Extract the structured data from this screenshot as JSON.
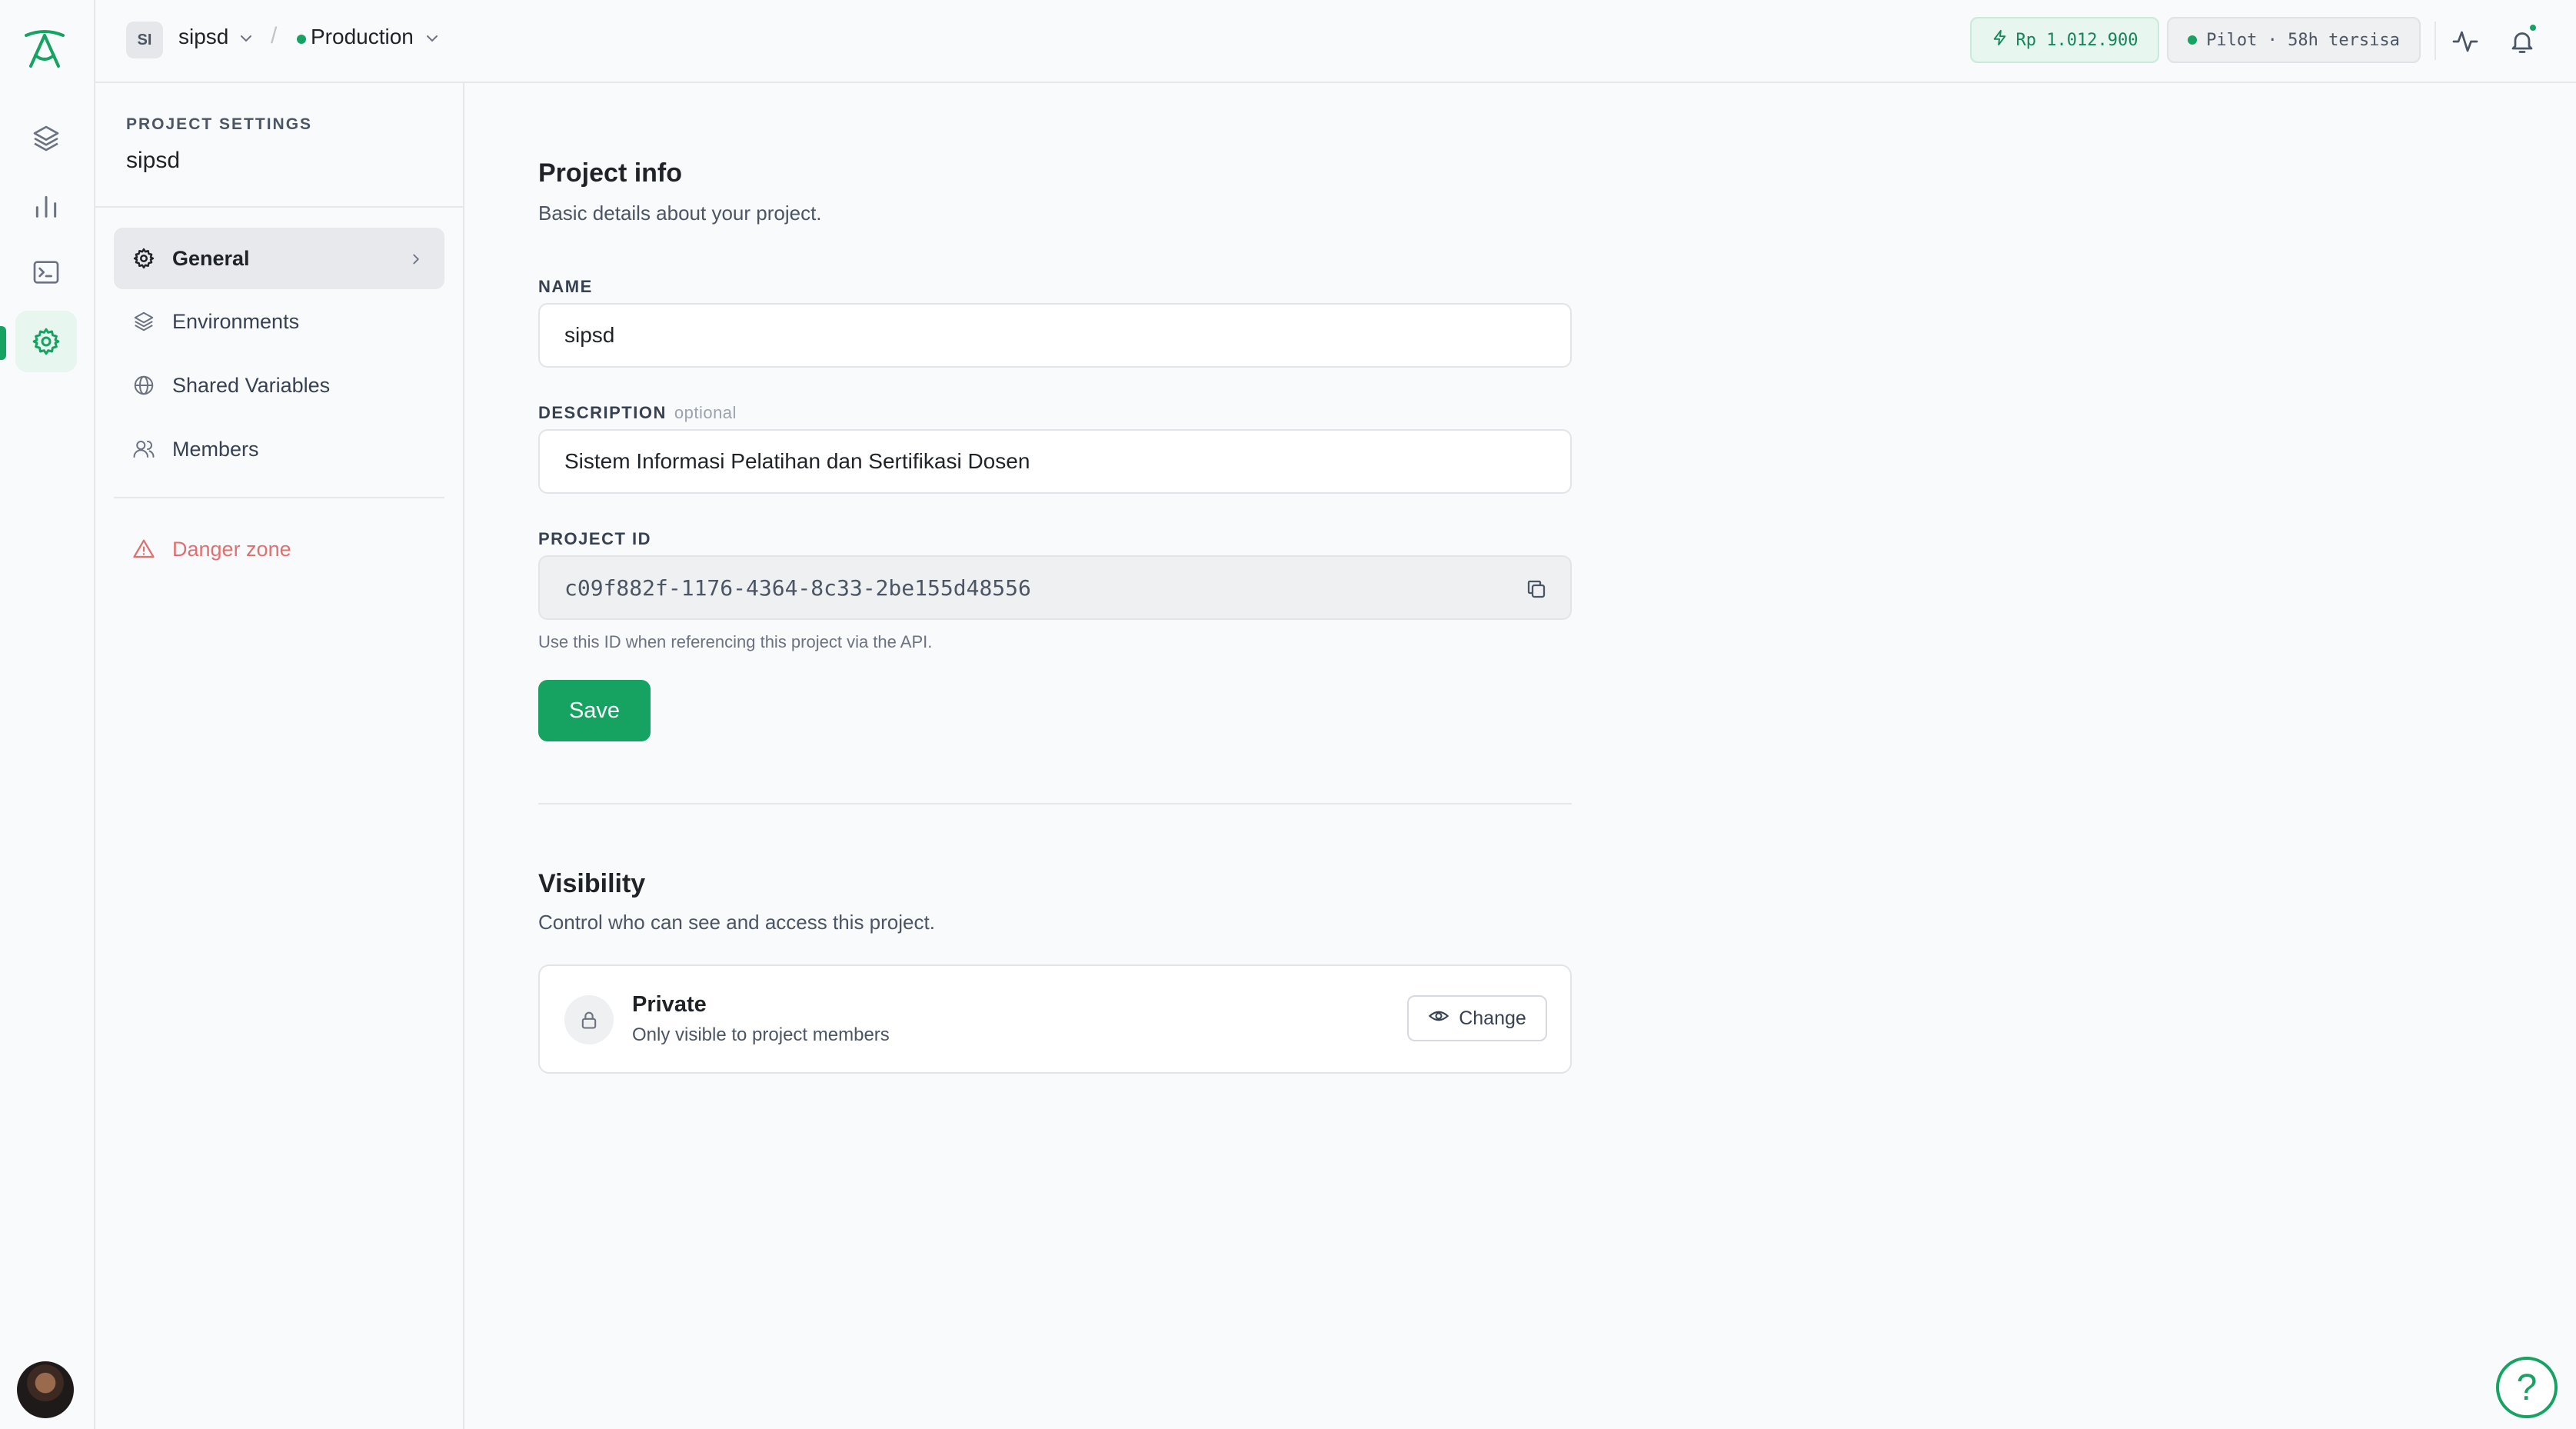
{
  "topbar": {
    "project_badge": "SI",
    "project_name": "sipsd",
    "separator": "/",
    "environment": "Production",
    "credit": "Rp 1.012.900",
    "plan": "Pilot · 58h tersisa"
  },
  "settings_sidebar": {
    "kicker": "PROJECT SETTINGS",
    "project": "sipsd",
    "items": [
      {
        "label": "General",
        "icon": "gear-icon",
        "active": true
      },
      {
        "label": "Environments",
        "icon": "layers-icon",
        "active": false
      },
      {
        "label": "Shared Variables",
        "icon": "globe-icon",
        "active": false
      },
      {
        "label": "Members",
        "icon": "users-icon",
        "active": false
      }
    ],
    "danger": "Danger zone"
  },
  "project_info": {
    "title": "Project info",
    "subtitle": "Basic details about your project.",
    "name_label": "NAME",
    "name_value": "sipsd",
    "description_label": "DESCRIPTION",
    "description_optional": "optional",
    "description_value": "Sistem Informasi Pelatihan dan Sertifikasi Dosen",
    "id_label": "PROJECT ID",
    "id_value": "c09f882f-1176-4364-8c33-2be155d48556",
    "id_hint": "Use this ID when referencing this project via the API.",
    "save_label": "Save"
  },
  "visibility": {
    "title": "Visibility",
    "subtitle": "Control who can see and access this project.",
    "state": "Private",
    "state_desc": "Only visible to project members",
    "change_label": "Change"
  },
  "help": "?",
  "colors": {
    "accent": "#16a362",
    "danger": "#e07070"
  }
}
